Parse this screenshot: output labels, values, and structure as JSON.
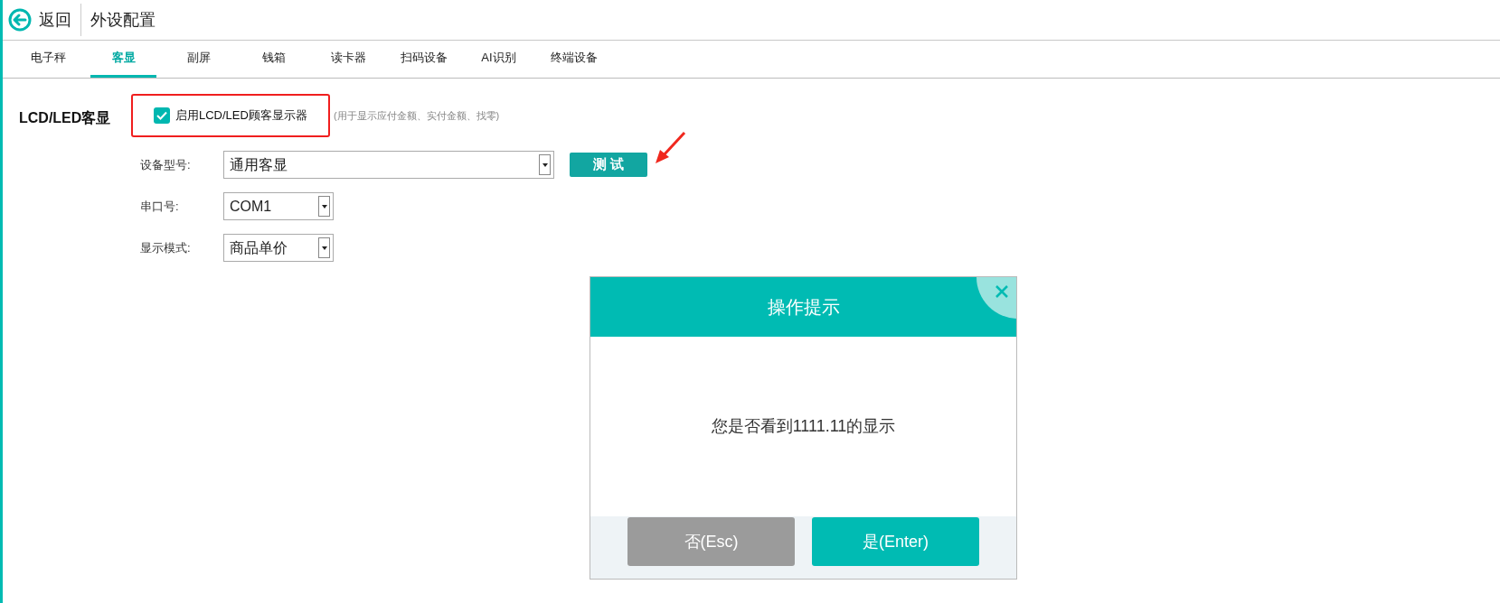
{
  "header": {
    "back_label": "返回",
    "title": "外设配置"
  },
  "tabs": [
    {
      "label": "电子秤",
      "selected": false
    },
    {
      "label": "客显",
      "selected": true
    },
    {
      "label": "副屏",
      "selected": false
    },
    {
      "label": "钱箱",
      "selected": false
    },
    {
      "label": "读卡器",
      "selected": false
    },
    {
      "label": "扫码设备",
      "selected": false
    },
    {
      "label": "AI识别",
      "selected": false
    },
    {
      "label": "终端设备",
      "selected": false
    }
  ],
  "section": {
    "title": "LCD/LED客显",
    "enable": {
      "label": "启用LCD/LED顾客显示器",
      "checked": true,
      "hint": "(用于显示应付金额、实付金额、找零)"
    },
    "fields": [
      {
        "label": "设备型号:",
        "value": "通用客显",
        "wide": true
      },
      {
        "label": "串口号:",
        "value": "COM1",
        "wide": false
      },
      {
        "label": "显示模式:",
        "value": "商品单价",
        "wide": false
      }
    ],
    "test_button": "测 试"
  },
  "dialog": {
    "title": "操作提示",
    "message": "您是否看到1111.11的显示",
    "buttons": [
      {
        "label": "否(Esc)",
        "kind": "cancel"
      },
      {
        "label": "是(Enter)",
        "kind": "confirm"
      }
    ]
  }
}
